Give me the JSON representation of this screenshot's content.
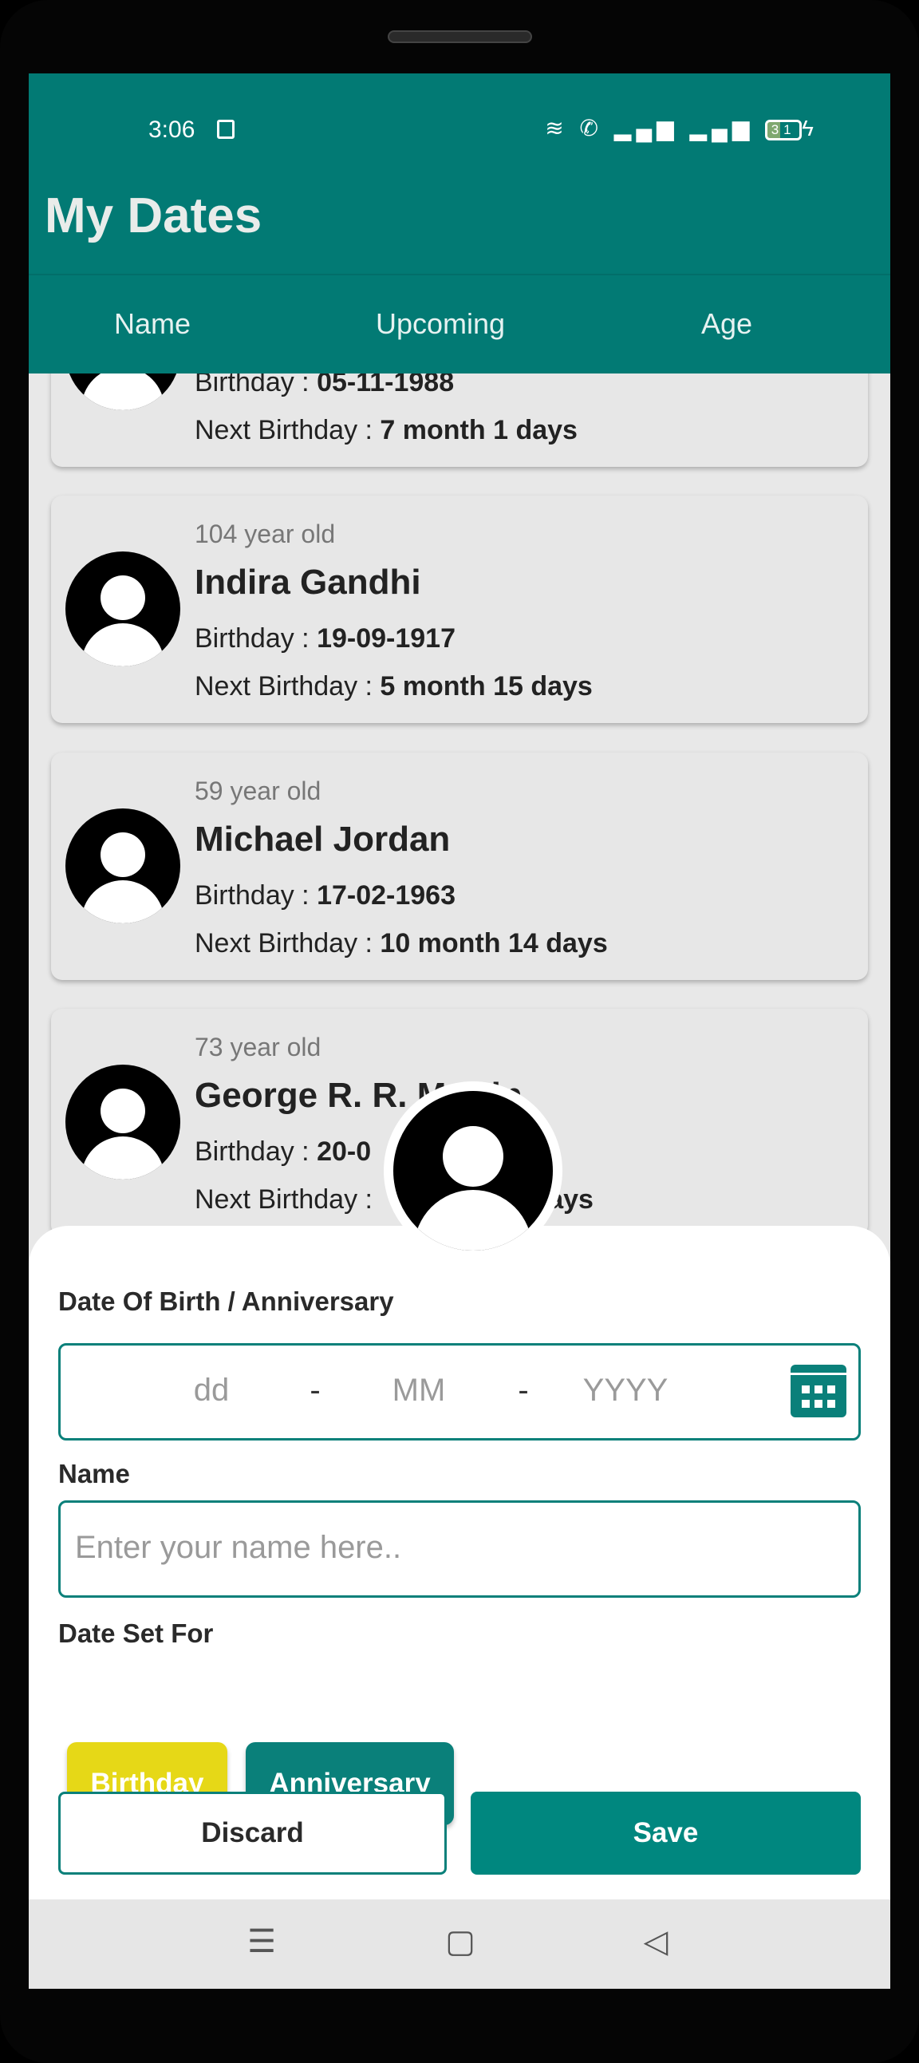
{
  "status_bar": {
    "time": "3:06",
    "battery": "31",
    "icons": [
      "notes-icon",
      "wifi-icon",
      "wifi-call-icon",
      "signal-icon",
      "signal-icon",
      "battery-icon",
      "charging-icon"
    ]
  },
  "app": {
    "title": "My Dates"
  },
  "tabs": [
    {
      "label": "Name"
    },
    {
      "label": "Upcoming"
    },
    {
      "label": "Age"
    }
  ],
  "cards": [
    {
      "age": "",
      "name": "",
      "birthday_label": "Birthday : ",
      "birthday": "05-11-1988",
      "next_label": "Next Birthday : ",
      "next": "7 month 1 days"
    },
    {
      "age": "104 year old",
      "name": "Indira Gandhi",
      "birthday_label": "Birthday : ",
      "birthday": "19-09-1917",
      "next_label": "Next Birthday : ",
      "next": "5 month 15 days"
    },
    {
      "age": "59 year old",
      "name": "Michael Jordan",
      "birthday_label": "Birthday : ",
      "birthday": "17-02-1963",
      "next_label": "Next Birthday : ",
      "next": "10 month 14 days"
    },
    {
      "age": "73 year old",
      "name": "George R. R. Martin",
      "birthday_label": "Birthday : ",
      "birthday": "20-0",
      "next_label": "Next Birthday : ",
      "next": "days"
    }
  ],
  "form": {
    "date_label": "Date Of Birth / Anniversary",
    "dd_placeholder": "dd",
    "mm_placeholder": "MM",
    "yyyy_placeholder": "YYYY",
    "separator": "-",
    "name_label": "Name",
    "name_placeholder": "Enter your name here..",
    "name_value": "",
    "set_for_label": "Date Set For",
    "options": [
      {
        "label": "Birthday",
        "selected": true
      },
      {
        "label": "Anniversary",
        "selected": false
      }
    ],
    "discard": "Discard",
    "save": "Save"
  },
  "colors": {
    "primary": "#027a74",
    "accent": "#0a807a",
    "selected": "#e6d817"
  },
  "nav": {
    "icons": [
      "menu-icon",
      "home-icon",
      "back-icon"
    ]
  }
}
